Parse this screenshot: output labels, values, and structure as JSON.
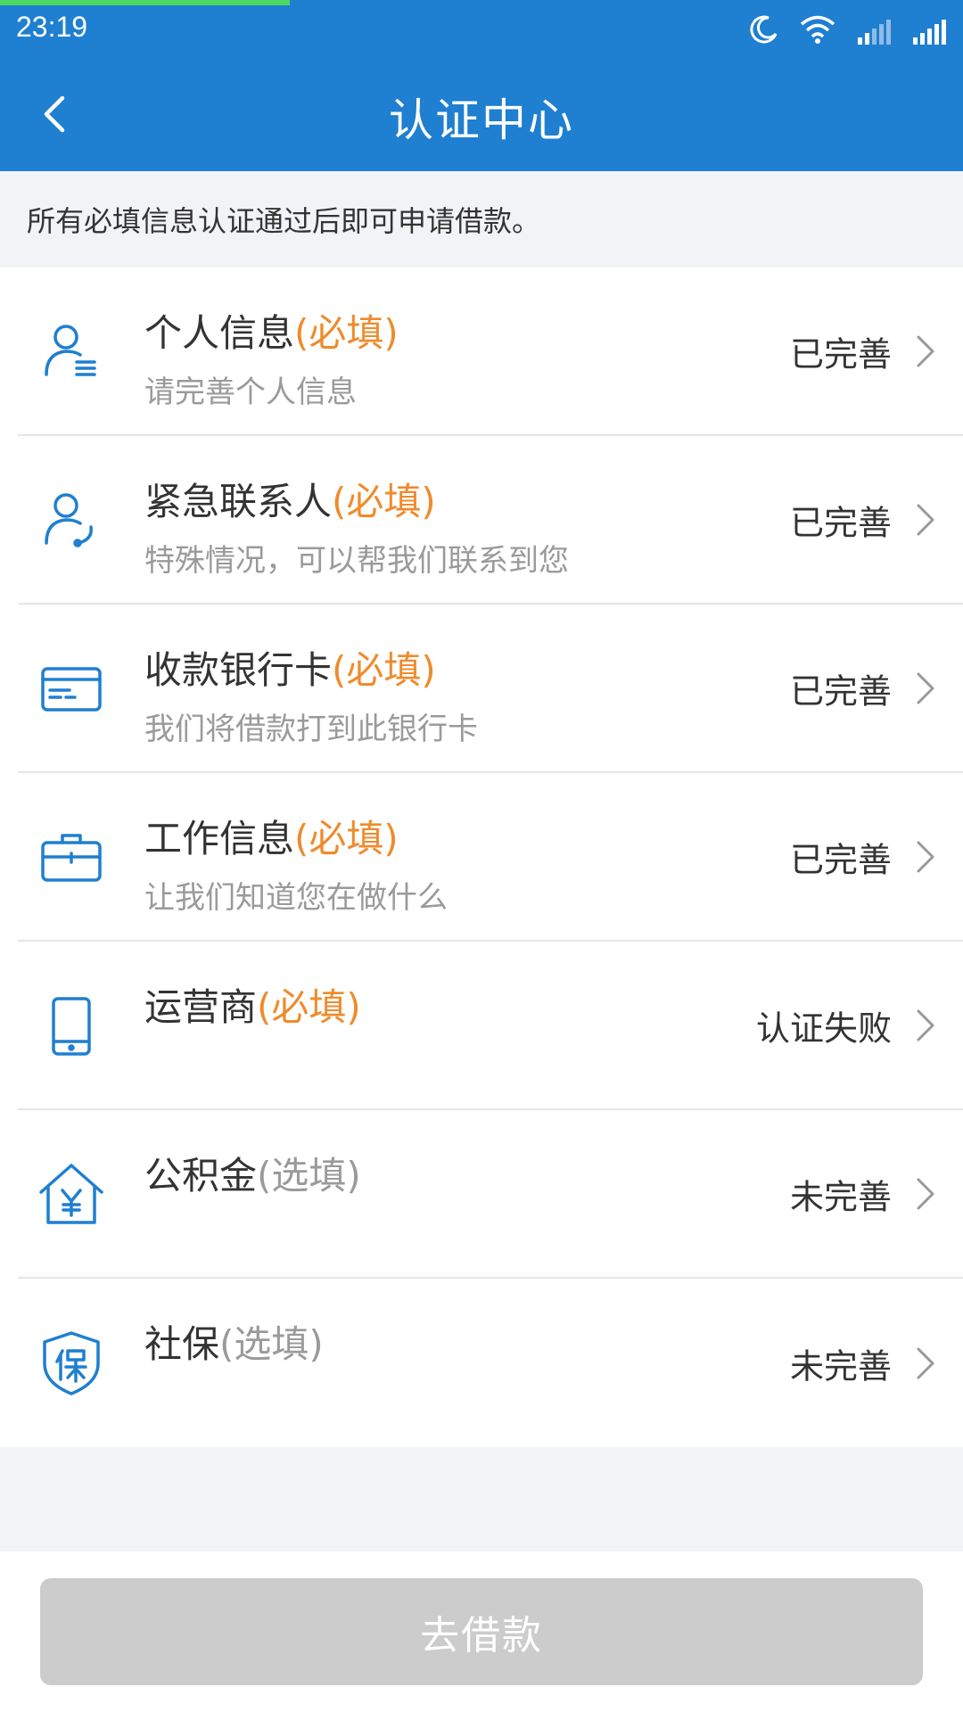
{
  "status_bar": {
    "time": "23:19"
  },
  "header": {
    "title": "认证中心"
  },
  "notice": "所有必填信息认证通过后即可申请借款。",
  "items": [
    {
      "title": "个人信息",
      "tag": "(必填)",
      "tag_type": "required",
      "subtitle": "请完善个人信息",
      "status": "已完善",
      "icon": "person-list-icon"
    },
    {
      "title": "紧急联系人",
      "tag": "(必填)",
      "tag_type": "required",
      "subtitle": "特殊情况，可以帮我们联系到您",
      "status": "已完善",
      "icon": "contact-phone-icon"
    },
    {
      "title": "收款银行卡",
      "tag": "(必填)",
      "tag_type": "required",
      "subtitle": "我们将借款打到此银行卡",
      "status": "已完善",
      "icon": "bank-card-icon"
    },
    {
      "title": "工作信息",
      "tag": "(必填)",
      "tag_type": "required",
      "subtitle": "让我们知道您在做什么",
      "status": "已完善",
      "icon": "briefcase-icon"
    },
    {
      "title": "运营商",
      "tag": "(必填)",
      "tag_type": "required",
      "subtitle": "",
      "status": "认证失败",
      "icon": "phone-icon"
    },
    {
      "title": "公积金",
      "tag": "(选填)",
      "tag_type": "optional",
      "subtitle": "",
      "status": "未完善",
      "icon": "house-yuan-icon"
    },
    {
      "title": "社保",
      "tag": "(选填)",
      "tag_type": "optional",
      "subtitle": "",
      "status": "未完善",
      "icon": "shield-bao-icon"
    }
  ],
  "footer": {
    "button_label": "去借款"
  },
  "colors": {
    "primary": "#1f7fd0",
    "required": "#ef8b2c",
    "optional": "#9a9a9a",
    "button_disabled": "#cccccc"
  }
}
